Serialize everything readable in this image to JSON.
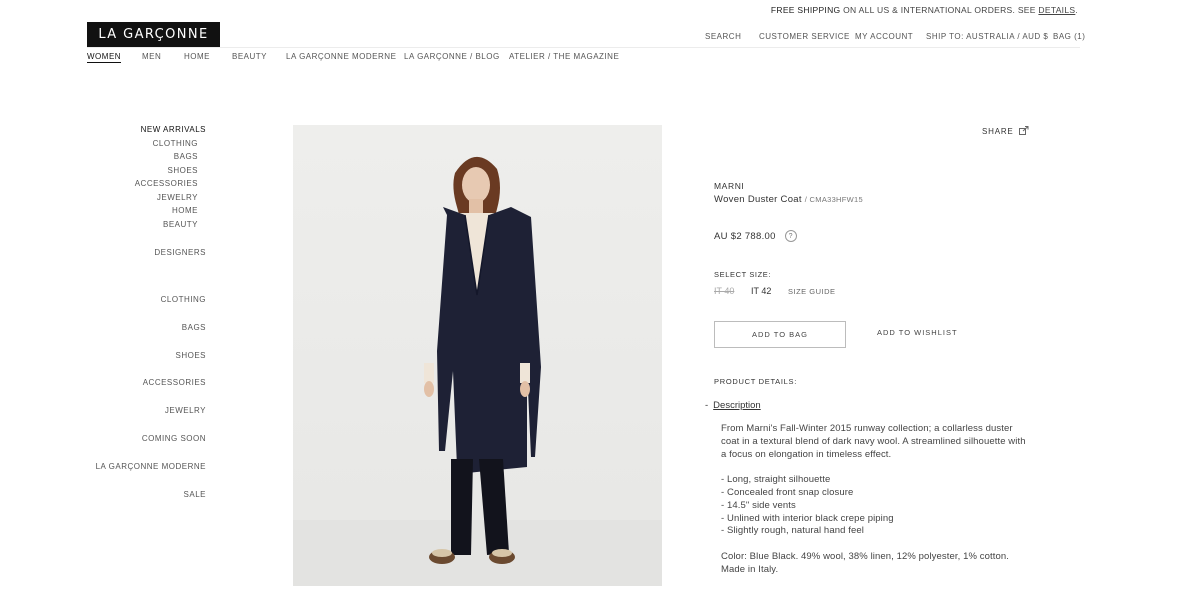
{
  "promo": {
    "pre": "FREE SHIPPING",
    "mid": " ON ALL US & INTERNATIONAL ORDERS. SEE ",
    "link": "DETAILS",
    "post": "."
  },
  "logo": "LA GARÇONNE",
  "util_nav": {
    "search": "SEARCH",
    "customer_service": "CUSTOMER SERVICE",
    "account": "MY ACCOUNT",
    "ship_to": "SHIP TO: AUSTRALIA  / AUD $",
    "bag": "BAG (1)"
  },
  "main_nav": [
    "WOMEN",
    "MEN",
    "HOME",
    "BEAUTY",
    "LA GARÇONNE MODERNE",
    "LA GARÇONNE / BLOG",
    "ATELIER / THE MAGAZINE"
  ],
  "sidebar": {
    "new_arrivals": "NEW ARRIVALS",
    "new_sub": [
      "CLOTHING",
      "BAGS",
      "SHOES",
      "ACCESSORIES",
      "JEWELRY",
      "HOME",
      "BEAUTY"
    ],
    "designers": "DESIGNERS",
    "categories": [
      "CLOTHING",
      "BAGS",
      "SHOES",
      "ACCESSORIES",
      "JEWELRY",
      "COMING SOON",
      "LA GARÇONNE MODERNE",
      "SALE"
    ]
  },
  "product": {
    "share": "SHARE",
    "brand": "MARNI",
    "name": "Woven Duster Coat",
    "code": "/ CMA33HFW15",
    "price": "AU $2 788.00",
    "price_help": "?",
    "select_size_label": "SELECT SIZE:",
    "sizes": [
      "IT 40",
      "IT 42"
    ],
    "size_guide": "SIZE GUIDE",
    "add_to_bag": "ADD TO BAG",
    "add_to_wishlist": "ADD TO WISHLIST",
    "details_label": "PRODUCT DETAILS:",
    "desc_toggle": "-",
    "desc_link": "Description",
    "desc_lines": [
      "From Marni's Fall-Winter 2015 runway collection; a collarless duster",
      "coat in a textural blend of dark navy wool. A streamlined silhouette with",
      "a focus on elongation in timeless effect.",
      "",
      "- Long, straight silhouette",
      "- Concealed front snap closure",
      "- 14.5\" side vents",
      "- Unlined with interior black crepe piping",
      "- Slightly rough, natural hand feel",
      "",
      "Color: Blue Black. 49% wool, 38% linen, 12% polyester, 1% cotton.",
      "Made in Italy."
    ]
  },
  "icons": {
    "share": "share-icon",
    "help": "help-icon"
  }
}
